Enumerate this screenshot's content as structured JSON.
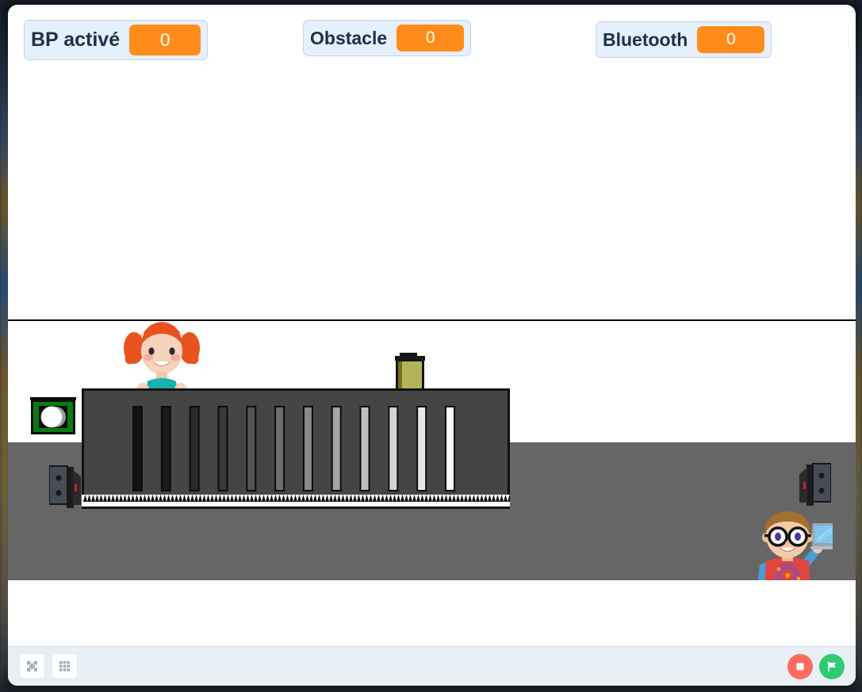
{
  "window": {
    "title": "Scratch Stage Player",
    "background_color": "#ffffff"
  },
  "monitors": [
    {
      "id": "bp-active",
      "label": "BP activé",
      "value": "0",
      "value_color": "#ff8c1a",
      "label_color": "#203046"
    },
    {
      "id": "obstacle",
      "label": "Obstacle",
      "value": "0",
      "value_color": "#ff8c1a",
      "label_color": "#203046"
    },
    {
      "id": "bluetooth",
      "label": "Bluetooth",
      "value": "0",
      "value_color": "#ff8c1a",
      "label_color": "#203046"
    }
  ],
  "stage": {
    "background_top_color": "#ffffff",
    "ground_color": "#666666",
    "horizon_line_color": "#000000",
    "sprites": [
      {
        "name": "girl",
        "description": "girl with orange pigtails and teal shirt"
      },
      {
        "name": "bin",
        "description": "olive green bin"
      },
      {
        "name": "sensor-sign",
        "description": "green square sensor with white circle"
      },
      {
        "name": "post-left",
        "description": "dark gray gate post, left"
      },
      {
        "name": "post-right",
        "description": "dark gray gate post, right"
      },
      {
        "name": "gate-barrier",
        "description": "dark gray sliding gate with vertical bars"
      },
      {
        "name": "boy",
        "description": "boy with glasses holding a laptop"
      }
    ],
    "gate": {
      "panel_color": "#454545",
      "bar_count": 12,
      "bar_shades": [
        "#121212",
        "#1c1c1c",
        "#2a2a2a",
        "#3a3a3a",
        "#545454",
        "#6e6e6e",
        "#8a8a8a",
        "#a5a5a5",
        "#c0c0c0",
        "#d4d4d4",
        "#e8e8e8",
        "#f8f8f8"
      ]
    }
  },
  "toolbar": {
    "left_buttons": [
      {
        "id": "small-stage",
        "icon": "shrink-icon",
        "label": "Small stage layout"
      },
      {
        "id": "full-screen",
        "icon": "grid-icon",
        "label": "Full screen control"
      }
    ],
    "right_buttons": [
      {
        "id": "stop",
        "icon": "stop-icon",
        "label": "Stop",
        "color": "#ff6b5e"
      },
      {
        "id": "green",
        "icon": "green-flag-icon",
        "label": "Go (flag)",
        "color": "#2ecc71"
      }
    ]
  }
}
